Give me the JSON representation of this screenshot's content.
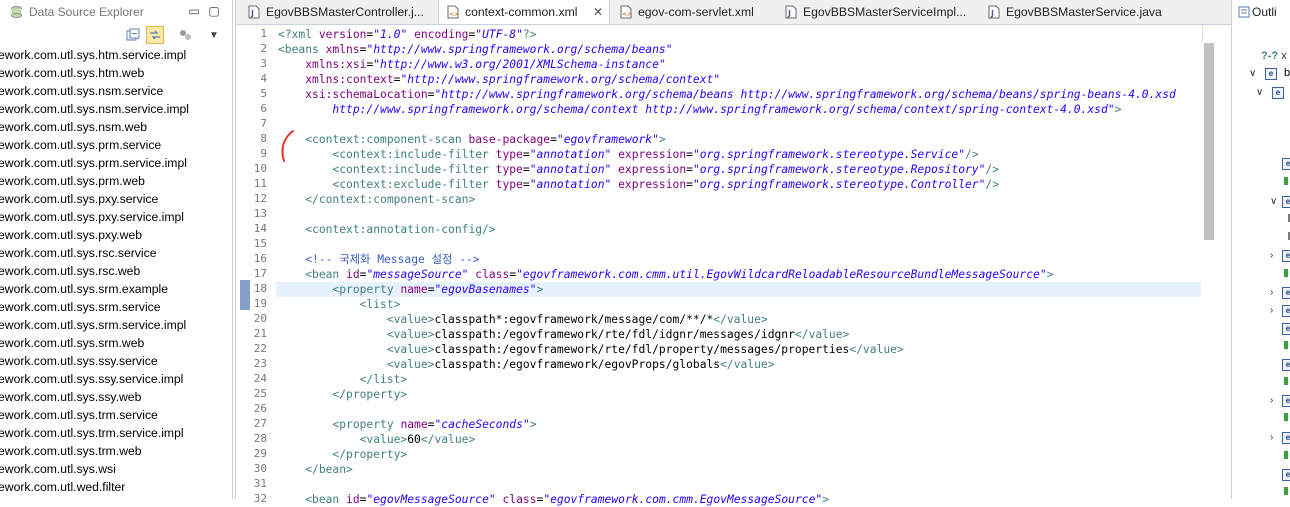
{
  "left_panel": {
    "title": "Data Source Explorer",
    "items": [
      "ework.com.utl.sys.htm.service.impl",
      "ework.com.utl.sys.htm.web",
      "ework.com.utl.sys.nsm.service",
      "ework.com.utl.sys.nsm.service.impl",
      "ework.com.utl.sys.nsm.web",
      "ework.com.utl.sys.prm.service",
      "ework.com.utl.sys.prm.service.impl",
      "ework.com.utl.sys.prm.web",
      "ework.com.utl.sys.pxy.service",
      "ework.com.utl.sys.pxy.service.impl",
      "ework.com.utl.sys.pxy.web",
      "ework.com.utl.sys.rsc.service",
      "ework.com.utl.sys.rsc.web",
      "ework.com.utl.sys.srm.example",
      "ework.com.utl.sys.srm.service",
      "ework.com.utl.sys.srm.service.impl",
      "ework.com.utl.sys.srm.web",
      "ework.com.utl.sys.ssy.service",
      "ework.com.utl.sys.ssy.service.impl",
      "ework.com.utl.sys.ssy.web",
      "ework.com.utl.sys.trm.service",
      "ework.com.utl.sys.trm.service.impl",
      "ework.com.utl.sys.trm.web",
      "ework.com.utl.sys.wsi",
      "ework.com.utl.wed.filter"
    ]
  },
  "tabs": [
    {
      "label": "EgovBBSMasterController.j...",
      "active": false,
      "closable": false
    },
    {
      "label": "context-common.xml",
      "active": true,
      "closable": true
    },
    {
      "label": "egov-com-servlet.xml",
      "active": false,
      "closable": false
    },
    {
      "label": "EgovBBSMasterServiceImpl...",
      "active": false,
      "closable": false
    },
    {
      "label": "EgovBBSMasterService.java",
      "active": false,
      "closable": false
    }
  ],
  "right_panel": {
    "title": "Outli",
    "first_item": "x",
    "second_item": "b"
  },
  "code": [
    [
      [
        "pi",
        "<?xml "
      ],
      [
        "attr",
        "version"
      ],
      [
        "txt",
        "="
      ],
      [
        "val",
        "\"1.0\""
      ],
      [
        "txt",
        " "
      ],
      [
        "attr",
        "encoding"
      ],
      [
        "txt",
        "="
      ],
      [
        "val",
        "\"UTF-8\""
      ],
      [
        "pi",
        "?>"
      ]
    ],
    [
      [
        "tag",
        "<beans "
      ],
      [
        "attr",
        "xmlns"
      ],
      [
        "txt",
        "="
      ],
      [
        "val",
        "\"http://www.springframework.org/schema/beans\""
      ]
    ],
    [
      [
        "txt",
        "    "
      ],
      [
        "attr",
        "xmlns:xsi"
      ],
      [
        "txt",
        "="
      ],
      [
        "val",
        "\"http://www.w3.org/2001/XMLSchema-instance\""
      ]
    ],
    [
      [
        "txt",
        "    "
      ],
      [
        "attr",
        "xmlns:context"
      ],
      [
        "txt",
        "="
      ],
      [
        "val",
        "\"http://www.springframework.org/schema/context\""
      ]
    ],
    [
      [
        "txt",
        "    "
      ],
      [
        "attr",
        "xsi:schemaLocation"
      ],
      [
        "txt",
        "="
      ],
      [
        "val",
        "\"http://www.springframework.org/schema/beans http://www.springframework.org/schema/beans/spring-beans-4.0.xsd"
      ]
    ],
    [
      [
        "val",
        "        http://www.springframework.org/schema/context http://www.springframework.org/schema/context/spring-context-4.0.xsd\""
      ],
      [
        "tag",
        ">"
      ]
    ],
    [],
    [
      [
        "txt",
        "    "
      ],
      [
        "tag",
        "<context:component-scan "
      ],
      [
        "attr",
        "base-package"
      ],
      [
        "txt",
        "="
      ],
      [
        "val",
        "\"egovframework\""
      ],
      [
        "tag",
        ">"
      ]
    ],
    [
      [
        "txt",
        "        "
      ],
      [
        "tag",
        "<context:include-filter "
      ],
      [
        "attr",
        "type"
      ],
      [
        "txt",
        "="
      ],
      [
        "val",
        "\"annotation\""
      ],
      [
        "txt",
        " "
      ],
      [
        "attr",
        "expression"
      ],
      [
        "txt",
        "="
      ],
      [
        "val",
        "\"org.springframework.stereotype.Service\""
      ],
      [
        "tag",
        "/>"
      ]
    ],
    [
      [
        "txt",
        "        "
      ],
      [
        "tag",
        "<context:include-filter "
      ],
      [
        "attr",
        "type"
      ],
      [
        "txt",
        "="
      ],
      [
        "val",
        "\"annotation\""
      ],
      [
        "txt",
        " "
      ],
      [
        "attr",
        "expression"
      ],
      [
        "txt",
        "="
      ],
      [
        "val",
        "\"org.springframework.stereotype.Repository\""
      ],
      [
        "tag",
        "/>"
      ]
    ],
    [
      [
        "txt",
        "        "
      ],
      [
        "tag",
        "<context:exclude-filter "
      ],
      [
        "attr",
        "type"
      ],
      [
        "txt",
        "="
      ],
      [
        "val",
        "\"annotation\""
      ],
      [
        "txt",
        " "
      ],
      [
        "attr",
        "expression"
      ],
      [
        "txt",
        "="
      ],
      [
        "val",
        "\"org.springframework.stereotype.Controller\""
      ],
      [
        "tag",
        "/>"
      ]
    ],
    [
      [
        "txt",
        "    "
      ],
      [
        "tag",
        "</context:component-scan>"
      ]
    ],
    [],
    [
      [
        "txt",
        "    "
      ],
      [
        "tag",
        "<context:annotation-config/>"
      ]
    ],
    [],
    [
      [
        "txt",
        "    "
      ],
      [
        "cmt",
        "<!-- 국제화 Message 설정 -->"
      ]
    ],
    [
      [
        "txt",
        "    "
      ],
      [
        "tag",
        "<bean "
      ],
      [
        "attr",
        "id"
      ],
      [
        "txt",
        "="
      ],
      [
        "val",
        "\"messageSource\""
      ],
      [
        "txt",
        " "
      ],
      [
        "attr",
        "class"
      ],
      [
        "txt",
        "="
      ],
      [
        "val",
        "\"egovframework.com.cmm.util.EgovWildcardReloadableResourceBundleMessageSource\""
      ],
      [
        "tag",
        ">"
      ]
    ],
    [
      [
        "txt",
        "        "
      ],
      [
        "tag",
        "<property "
      ],
      [
        "attr",
        "name"
      ],
      [
        "txt",
        "="
      ],
      [
        "val",
        "\"egovBasenames\""
      ],
      [
        "tag",
        ">"
      ]
    ],
    [
      [
        "txt",
        "            "
      ],
      [
        "tag",
        "<list>"
      ]
    ],
    [
      [
        "txt",
        "                "
      ],
      [
        "tag",
        "<value>"
      ],
      [
        "txt",
        "classpath*:egovframework/message/com/**/*"
      ],
      [
        "tag",
        "</value>"
      ]
    ],
    [
      [
        "txt",
        "                "
      ],
      [
        "tag",
        "<value>"
      ],
      [
        "txt",
        "classpath:/egovframework/rte/fdl/idgnr/messages/idgnr"
      ],
      [
        "tag",
        "</value>"
      ]
    ],
    [
      [
        "txt",
        "                "
      ],
      [
        "tag",
        "<value>"
      ],
      [
        "txt",
        "classpath:/egovframework/rte/fdl/property/messages/properties"
      ],
      [
        "tag",
        "</value>"
      ]
    ],
    [
      [
        "txt",
        "                "
      ],
      [
        "tag",
        "<value>"
      ],
      [
        "txt",
        "classpath:/egovframework/egovProps/globals"
      ],
      [
        "tag",
        "</value>"
      ]
    ],
    [
      [
        "txt",
        "            "
      ],
      [
        "tag",
        "</list>"
      ]
    ],
    [
      [
        "txt",
        "        "
      ],
      [
        "tag",
        "</property>"
      ]
    ],
    [],
    [
      [
        "txt",
        "        "
      ],
      [
        "tag",
        "<property "
      ],
      [
        "attr",
        "name"
      ],
      [
        "txt",
        "="
      ],
      [
        "val",
        "\"cacheSeconds\""
      ],
      [
        "tag",
        ">"
      ]
    ],
    [
      [
        "txt",
        "            "
      ],
      [
        "tag",
        "<value>"
      ],
      [
        "txt",
        "60"
      ],
      [
        "tag",
        "</value>"
      ]
    ],
    [
      [
        "txt",
        "        "
      ],
      [
        "tag",
        "</property>"
      ]
    ],
    [
      [
        "txt",
        "    "
      ],
      [
        "tag",
        "</bean>"
      ]
    ],
    [],
    [
      [
        "txt",
        "    "
      ],
      [
        "tag",
        "<bean "
      ],
      [
        "attr",
        "id"
      ],
      [
        "txt",
        "="
      ],
      [
        "val",
        "\"egovMessageSource\""
      ],
      [
        "txt",
        " "
      ],
      [
        "attr",
        "class"
      ],
      [
        "txt",
        "="
      ],
      [
        "val",
        "\"egovframework.com.cmm.EgovMessageSource\""
      ],
      [
        "tag",
        ">"
      ]
    ]
  ],
  "highlighted_line": 18,
  "colors": {
    "tag": "#3f7f7f",
    "attribute": "#7f007f",
    "value": "#2a00ff",
    "comment": "#3f5fbf",
    "current_line": "#e8f2fe",
    "annotation_marker": "#e0302a"
  }
}
